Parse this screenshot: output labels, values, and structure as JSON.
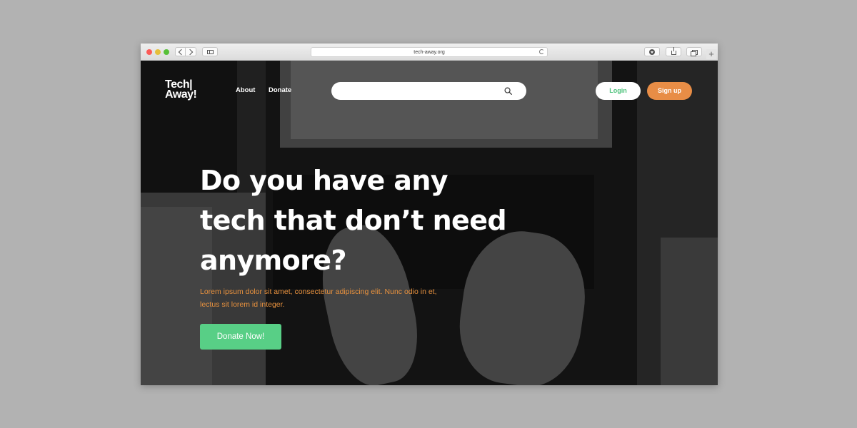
{
  "browser": {
    "url": "tech-away.org"
  },
  "site": {
    "logo_line1": "Tech|",
    "logo_line2": "Away!",
    "nav": {
      "about": "About",
      "donate": "Donate"
    },
    "search": {
      "value": "",
      "placeholder": "",
      "icon": "search-icon"
    },
    "login_label": "Login",
    "signup_label": "Sign up"
  },
  "hero": {
    "headline_line1": "Do you have any",
    "headline_line2": "tech that  don’t need",
    "headline_line3": "anymore?",
    "subtext": "Lorem ipsum dolor sit amet, consectetur adipiscing elit. Nunc odio in et, lectus sit lorem id integer.",
    "cta_label": "Donate Now!"
  },
  "colors": {
    "accent_green": "#58cf86",
    "accent_orange": "#e88d46",
    "subtext_orange": "#e7913e"
  }
}
